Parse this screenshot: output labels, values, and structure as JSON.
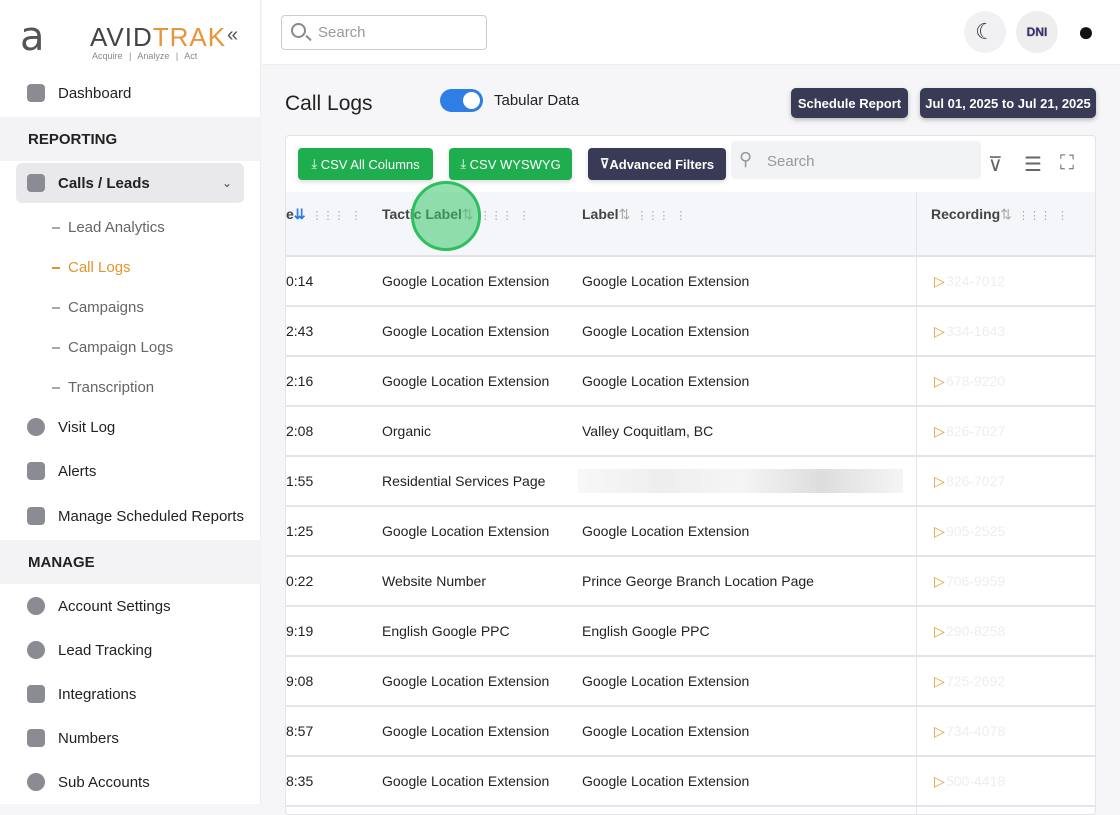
{
  "brand": {
    "name_a": "AVID",
    "name_b": "TRAK",
    "tagline": "Acquire | Analyze | Act"
  },
  "sidebar": {
    "dashboard": "Dashboard",
    "reporting": "REPORTING",
    "calls_leads": "Calls / Leads",
    "sub": [
      "Lead Analytics",
      "Call Logs",
      "Campaigns",
      "Campaign Logs",
      "Transcription"
    ],
    "visit_log": "Visit Log",
    "alerts": "Alerts",
    "manage_scheduled": "Manage Scheduled Reports",
    "manage": "MANAGE",
    "account_settings": "Account Settings",
    "lead_tracking": "Lead Tracking",
    "integrations": "Integrations",
    "numbers": "Numbers",
    "sub_accounts": "Sub Accounts"
  },
  "topbar": {
    "search_placeholder": "Search",
    "dni": "DNI"
  },
  "page": {
    "title": "Call Logs",
    "toggle_label": "Tabular Data",
    "toggle_on": true,
    "schedule": "Schedule Report",
    "date_range": "Jul 01, 2025 to Jul 21, 2025"
  },
  "toolbar": {
    "csv_all": "CSV All Columns",
    "csv_wyswyg": "CSV WYSWYG",
    "advanced": "Advanced Filters",
    "search_placeholder": "Search"
  },
  "columns": {
    "first": "e",
    "tactic": "Tactic Label",
    "label": "Label",
    "recording": "Recording"
  },
  "rows": [
    {
      "t": "0:14",
      "tactic": "Google Location Extension",
      "label": "Google Location Extension",
      "phone": "324-7012"
    },
    {
      "t": "2:43",
      "tactic": "Google Location Extension",
      "label": "Google Location Extension",
      "phone": "334-1643"
    },
    {
      "t": "2:16",
      "tactic": "Google Location Extension",
      "label": "Google Location Extension",
      "phone": "678-9220"
    },
    {
      "t": "2:08",
      "tactic": "Organic",
      "label": "Valley Coquitlam, BC",
      "phone": "826-7027"
    },
    {
      "t": "1:55",
      "tactic": "Residential Services Page",
      "label": "",
      "phone": "826-7027"
    },
    {
      "t": "1:25",
      "tactic": "Google Location Extension",
      "label": "Google Location Extension",
      "phone": "905-2525"
    },
    {
      "t": "0:22",
      "tactic": "Website Number",
      "label": "Prince George Branch Location Page",
      "phone": "706-9959"
    },
    {
      "t": "9:19",
      "tactic": "English Google PPC",
      "label": "English Google PPC",
      "phone": "290-8258"
    },
    {
      "t": "9:08",
      "tactic": "Google Location Extension",
      "label": "Google Location Extension",
      "phone": "725-2692"
    },
    {
      "t": "8:57",
      "tactic": "Google Location Extension",
      "label": "Google Location Extension",
      "phone": "734-4078"
    },
    {
      "t": "8:35",
      "tactic": "Google Location Extension",
      "label": "Google Location Extension",
      "phone": "500-4418"
    }
  ]
}
